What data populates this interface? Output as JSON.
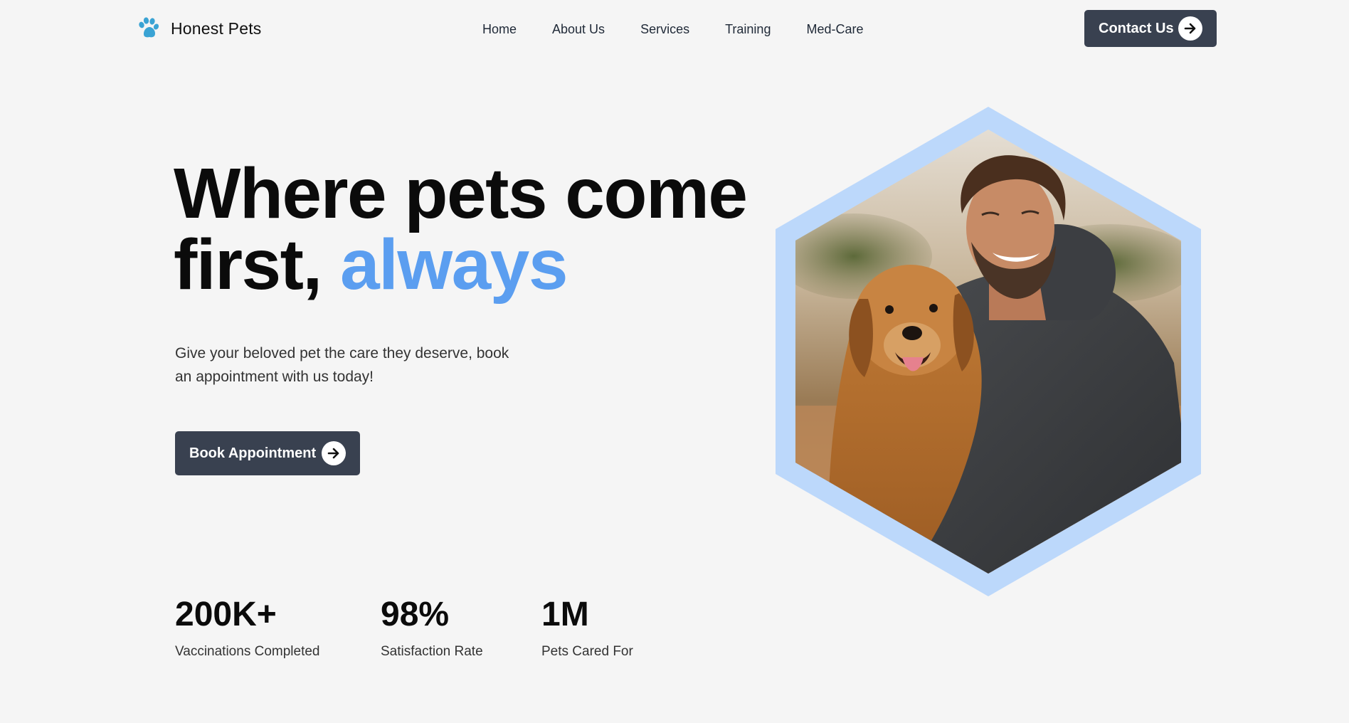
{
  "brand": {
    "name": "Honest Pets",
    "logo_icon": "paw-icon",
    "accent_color": "#3aa3d4"
  },
  "nav": {
    "items": [
      "Home",
      "About Us",
      "Services",
      "Training",
      "Med-Care"
    ]
  },
  "header": {
    "contact_label": "Contact Us",
    "contact_icon": "arrow-right-circle-icon"
  },
  "hero": {
    "title_line1": "Where pets come",
    "title_line2_plain": "first, ",
    "title_line2_accent": "always",
    "subtitle": "Give your beloved pet the care they deserve, book an appointment with us today!",
    "cta_label": "Book Appointment",
    "cta_icon": "arrow-right-circle-icon",
    "image_description_icon": "hexagon-photo"
  },
  "stats": [
    {
      "value": "200K+",
      "label": "Vaccinations Completed"
    },
    {
      "value": "98%",
      "label": "Satisfaction Rate"
    },
    {
      "value": "1M",
      "label": "Pets Cared For"
    }
  ],
  "colors": {
    "background": "#f5f5f5",
    "button_dark": "#394150",
    "title_accent": "#5b9ef0",
    "hex_frame": "#bcd8fb"
  }
}
